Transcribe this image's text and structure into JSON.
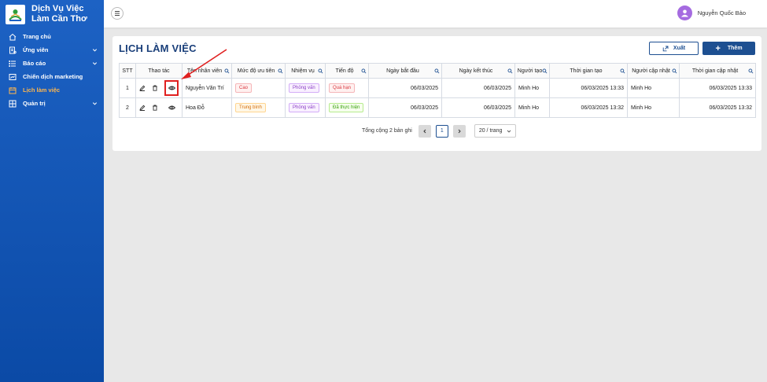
{
  "app": {
    "title": "Dịch Vụ Việc Làm Cần Thơ"
  },
  "sidebar": {
    "items": [
      {
        "label": "Trang chủ",
        "icon": "home-icon",
        "has_children": false,
        "active": false
      },
      {
        "label": "Ứng viên",
        "icon": "candidate-icon",
        "has_children": true,
        "active": false
      },
      {
        "label": "Báo cáo",
        "icon": "list-icon",
        "has_children": true,
        "active": false
      },
      {
        "label": "Chiến dịch marketing",
        "icon": "campaign-icon",
        "has_children": false,
        "active": false
      },
      {
        "label": "Lịch làm việc",
        "icon": "calendar-icon",
        "has_children": false,
        "active": true
      },
      {
        "label": "Quản trị",
        "icon": "admin-icon",
        "has_children": true,
        "active": false
      }
    ]
  },
  "header": {
    "user_name": "Nguyễn Quốc Bảo"
  },
  "page": {
    "title": "LỊCH LÀM VIỆC",
    "export_label": "Xuất",
    "add_label": "Thêm"
  },
  "table": {
    "columns": [
      "STT",
      "Thao tác",
      "Tên nhân viên",
      "Mức độ ưu tiên",
      "Nhiệm vụ",
      "Tiến độ",
      "Ngày bắt đầu",
      "Ngày kết thúc",
      "Người tạo",
      "Thời gian tạo",
      "Người cập nhật",
      "Thời gian cập nhật"
    ],
    "rows": [
      {
        "stt": "1",
        "name": "Nguyễn Văn Trí",
        "priority": "Cao",
        "task": "Phỏng vấn",
        "progress": "Quá hạn",
        "start": "06/03/2025",
        "end": "06/03/2025",
        "creator": "Minh Ho",
        "created": "06/03/2025 13:33",
        "updater": "Minh Ho",
        "updated": "06/03/2025 13:33"
      },
      {
        "stt": "2",
        "name": "Hoa Đỗ",
        "priority": "Trung bình",
        "task": "Phỏng vấn",
        "progress": "Đã thực hiện",
        "start": "06/03/2025",
        "end": "06/03/2025",
        "creator": "Minh Ho",
        "created": "06/03/2025 13:32",
        "updater": "Minh Ho",
        "updated": "06/03/2025 13:32"
      }
    ]
  },
  "pagination": {
    "total_text": "Tổng cộng 2 bản ghi",
    "current_page": "1",
    "page_size": "20 / trang"
  },
  "colors": {
    "sidebar": "#1558b8",
    "primary": "#1d4f91",
    "active_menu": "#ffb74d",
    "highlight": "#e02020"
  }
}
